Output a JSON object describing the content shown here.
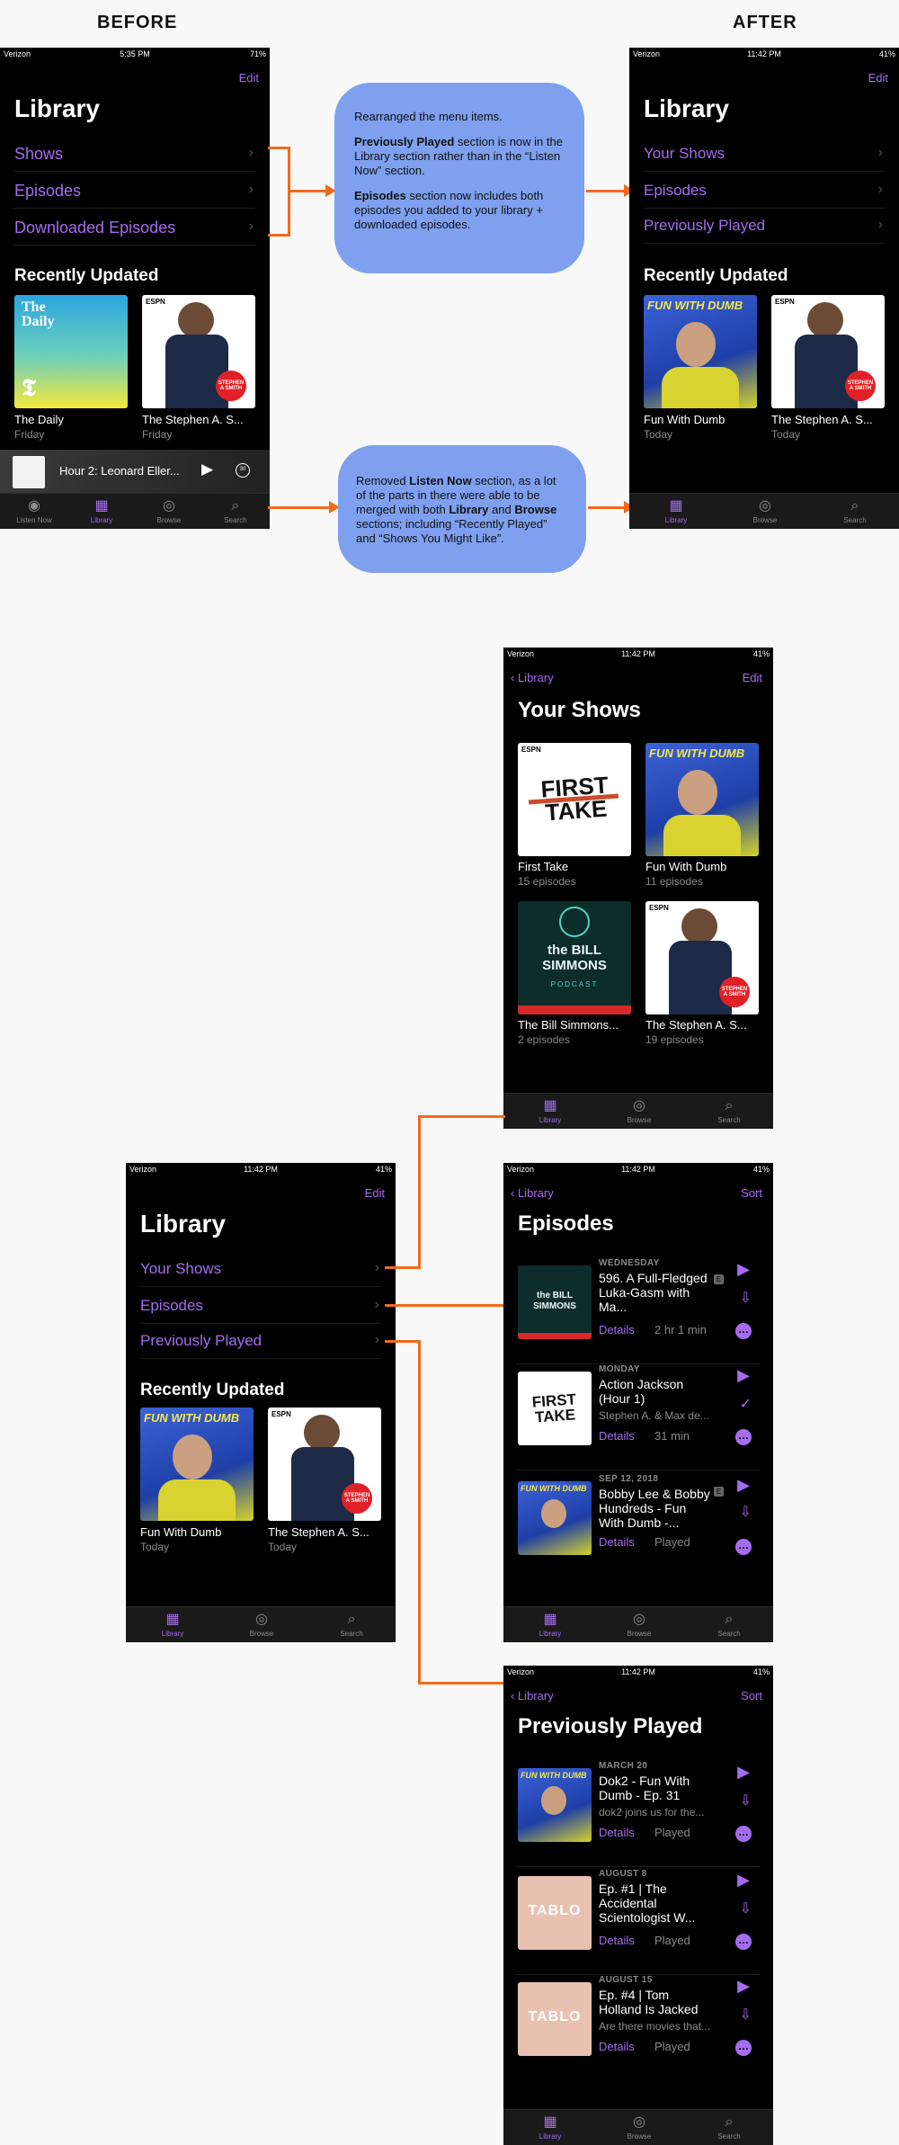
{
  "headings": {
    "before": "BEFORE",
    "after": "AFTER"
  },
  "status": {
    "before": {
      "carrier": "Verizon",
      "time": "5:35 PM",
      "battery": "71%"
    },
    "after": {
      "carrier": "Verizon",
      "time": "11:42 PM",
      "battery": "41%"
    }
  },
  "library": {
    "title": "Library",
    "edit": "Edit",
    "before_items": [
      "Shows",
      "Episodes",
      "Downloaded Episodes"
    ],
    "after_items": [
      "Your Shows",
      "Episodes",
      "Previously Played"
    ],
    "recently_updated": "Recently Updated",
    "before_cards": [
      {
        "name": "The Daily",
        "sub": "Friday"
      },
      {
        "name": "The Stephen A. S...",
        "sub": "Friday"
      }
    ],
    "after_cards": [
      {
        "name": "Fun With Dumb",
        "sub": "Today"
      },
      {
        "name": "The Stephen A. S...",
        "sub": "Today"
      }
    ]
  },
  "now_playing": {
    "title": "Hour 2: Leonard Eller...",
    "skip": "30"
  },
  "tabs": {
    "before": [
      "Listen Now",
      "Library",
      "Browse",
      "Search"
    ],
    "after": [
      "Library",
      "Browse",
      "Search"
    ]
  },
  "notes": {
    "menu": {
      "line1": "Rearranged the menu items.",
      "pp_bold": "Previously Played",
      "pp_rest": " section is now in the Library section rather than in the “Listen Now” section.",
      "ep_bold": "Episodes",
      "ep_rest": " section now includes both episodes you added to your library + downloaded episodes."
    },
    "listen": {
      "a": "Removed ",
      "b1": "Listen Now",
      "c": " section, as a lot of the parts in there were able to be merged with both ",
      "b2": "Library",
      "d": " and ",
      "b3": "Browse",
      "e": " sections; including “Recently Played” and “Shows You Might Like”."
    }
  },
  "your_shows": {
    "back": "Library",
    "edit": "Edit",
    "title": "Your Shows",
    "shows": [
      {
        "name": "First Take",
        "count": "15 episodes"
      },
      {
        "name": "Fun With Dumb",
        "count": "11 episodes"
      },
      {
        "name": "The Bill Simmons...",
        "count": "2 episodes"
      },
      {
        "name": "The Stephen A. S...",
        "count": "19 episodes"
      }
    ]
  },
  "episodes": {
    "back": "Library",
    "sort": "Sort",
    "title": "Episodes",
    "items": [
      {
        "day": "WEDNESDAY",
        "title": "596. A Full-Fledged Luka-Gasm with Ma...",
        "desc": "",
        "details": "Details",
        "meta": "2 hr 1 min"
      },
      {
        "day": "MONDAY",
        "title": "Action Jackson (Hour 1)",
        "desc": "Stephen A. & Max de...",
        "details": "Details",
        "meta": "31 min"
      },
      {
        "day": "SEP 12, 2018",
        "title": "Bobby Lee & Bobby Hundreds - Fun With Dumb -...",
        "desc": "",
        "details": "Details",
        "meta": "Played"
      }
    ]
  },
  "previously_played": {
    "back": "Library",
    "sort": "Sort",
    "title": "Previously Played",
    "items": [
      {
        "day": "MARCH 20",
        "title": "Dok2 - Fun With Dumb - Ep. 31",
        "desc": "dok2 joins us for the...",
        "details": "Details",
        "meta": "Played"
      },
      {
        "day": "AUGUST 8",
        "title": "Ep. #1 | The Accidental Scientologist W...",
        "desc": "",
        "details": "Details",
        "meta": "Played"
      },
      {
        "day": "AUGUST 15",
        "title": "Ep. #4 | Tom Holland Is Jacked",
        "desc": "Are there movies that...",
        "details": "Details",
        "meta": "Played"
      }
    ]
  },
  "art_text": {
    "daily": "The Daily",
    "fwd": "FUN WITH DUMB",
    "espn": "ESPN",
    "stephen": "STEPHEN A SMITH",
    "first_take": "FIRST TAKE",
    "bill": "the BILL SIMMONS",
    "podcast": "PODCAST",
    "tablo": "TABLO"
  },
  "colors": {
    "accent": "#a56cf0",
    "arrow": "#f26a1b",
    "note": "#7ea0ee"
  }
}
